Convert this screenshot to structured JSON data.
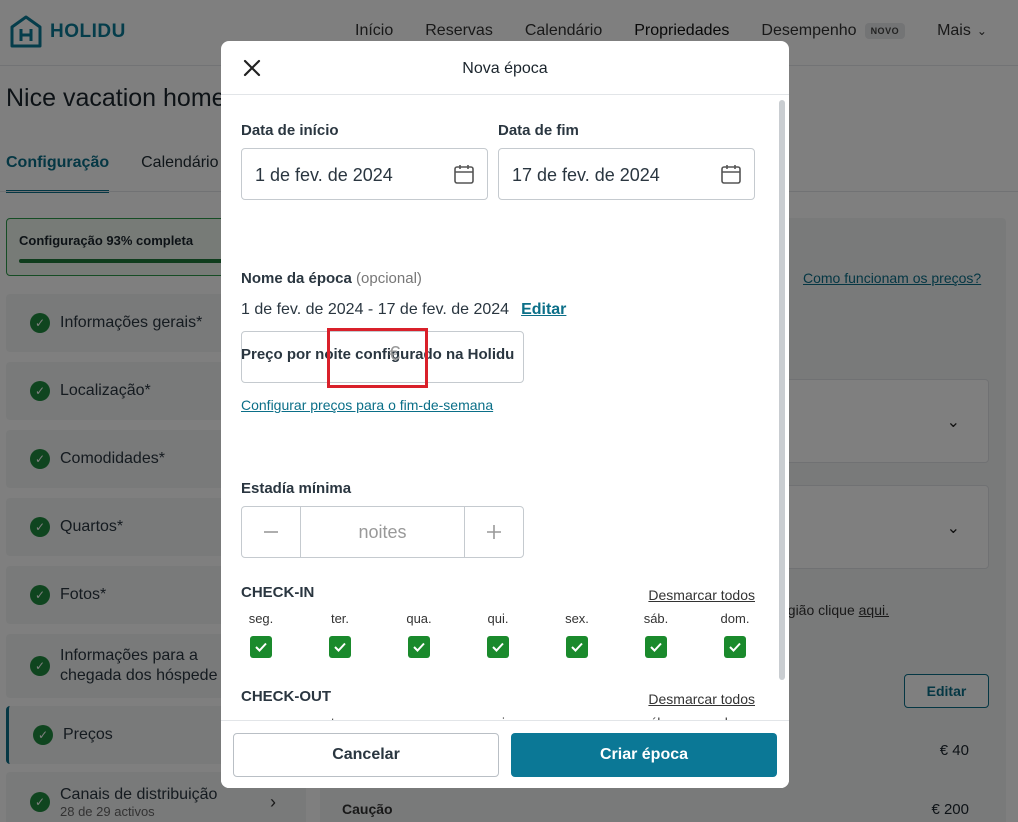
{
  "app": {
    "brand": "HOLIDU",
    "nav": [
      "Início",
      "Reservas",
      "Calendário",
      "Propriedades",
      "Desempenho",
      "Mais"
    ],
    "nav_badge": "NOVO"
  },
  "property": {
    "title": "Nice vacation home",
    "tabs": [
      "Configuração",
      "Calendário"
    ],
    "progress_label": "Configuração 93% completa",
    "progress_fraction": 0.93,
    "sidebar": [
      {
        "label": "Informações gerais*"
      },
      {
        "label": "Localização*"
      },
      {
        "label": "Comodidades*"
      },
      {
        "label": "Quartos*"
      },
      {
        "label": "Fotos*"
      },
      {
        "label": "Informações para a chegada dos hóspede"
      },
      {
        "label": "Preços"
      },
      {
        "label": "Canais de distribuição",
        "sub": "28 de 29 activos"
      }
    ],
    "pricing_help_link": "Como funcionam os preços?",
    "region_text": "egião clique ",
    "region_link": "aqui.",
    "edit_button": "Editar",
    "price_rows": [
      {
        "value": "€ 40"
      },
      {
        "label": "Caução",
        "value": "€ 200"
      }
    ]
  },
  "modal": {
    "title": "Nova época",
    "start_label": "Data de início",
    "start_value": "1 de fev. de 2024",
    "end_label": "Data de fim",
    "end_value": "17 de fev. de 2024",
    "season_name_label": "Nome da época",
    "season_name_optional": "(opcional)",
    "season_name_value": "1 de fev. de 2024 - 17 de fev. de 2024",
    "edit_link": "Editar",
    "price_label": "Preço por noite configurado na Holidu",
    "price_currency": "€",
    "weekend_link": "Configurar preços para o fim-de-semana",
    "min_stay_label": "Estadía mínima",
    "min_stay_placeholder": "noites",
    "checkin_title": "CHECK-IN",
    "checkout_title": "CHECK-OUT",
    "unselect_all": "Desmarcar todos",
    "days": [
      "seg.",
      "ter.",
      "qua.",
      "qui.",
      "sex.",
      "sáb.",
      "dom."
    ],
    "cancel": "Cancelar",
    "create": "Criar época"
  }
}
